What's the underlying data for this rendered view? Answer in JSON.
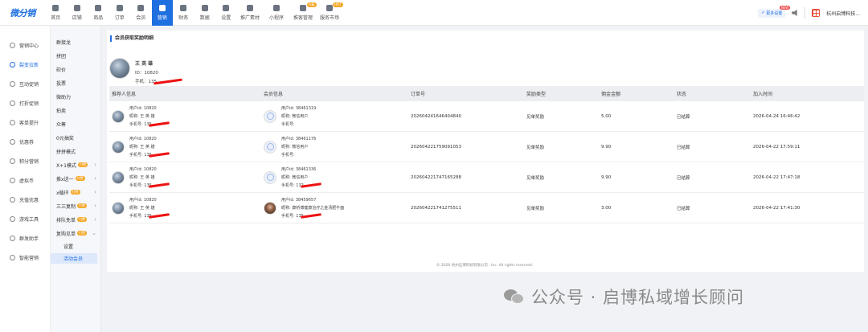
{
  "app": {
    "logo_text": "微分销"
  },
  "nav": [
    {
      "label": "首页",
      "icon": "home-icon"
    },
    {
      "label": "店铺",
      "icon": "shop-icon"
    },
    {
      "label": "商品",
      "icon": "goods-icon"
    },
    {
      "label": "订单",
      "icon": "order-icon"
    },
    {
      "label": "会员",
      "icon": "member-icon"
    },
    {
      "label": "营销",
      "icon": "marketing-icon",
      "active": true
    },
    {
      "label": "财务",
      "icon": "finance-icon"
    },
    {
      "label": "数据",
      "icon": "data-icon"
    },
    {
      "label": "设置",
      "icon": "settings-icon"
    },
    {
      "label": "推广素材",
      "icon": "share-icon"
    },
    {
      "label": "小程序",
      "icon": "miniapp-icon"
    },
    {
      "label": "推客管理",
      "icon": "promoter-icon",
      "tag": "升级"
    },
    {
      "label": "服务市场",
      "icon": "market-icon",
      "tag": "HOT"
    }
  ],
  "topright": {
    "more_settings": "更多设置",
    "new_badge": "NEW",
    "company": "杭州启博科技..."
  },
  "side1": [
    {
      "label": "营销中心"
    },
    {
      "label": "裂变拉新",
      "active": true
    },
    {
      "label": "互动促销"
    },
    {
      "label": "打折促销"
    },
    {
      "label": "客单提升"
    },
    {
      "label": "优惠券"
    },
    {
      "label": "积分营销"
    },
    {
      "label": "虚拟币"
    },
    {
      "label": "充值优惠"
    },
    {
      "label": "游戏工具"
    },
    {
      "label": "群发助手"
    },
    {
      "label": "智能营销"
    }
  ],
  "side2": {
    "items": [
      {
        "label": "群接龙"
      },
      {
        "label": "拼团"
      },
      {
        "label": "砍价"
      },
      {
        "label": "投票"
      },
      {
        "label": "微助力"
      },
      {
        "label": "拍卖"
      },
      {
        "label": "众筹"
      },
      {
        "label": "0元抽奖"
      },
      {
        "label": "拼拼模式"
      }
    ],
    "badged": [
      {
        "label": "X+1模式",
        "badge": "付费"
      },
      {
        "label": "推x送一",
        "badge": "付费"
      },
      {
        "label": "x循环",
        "badge": "付费"
      },
      {
        "label": "三三复制",
        "badge": "付费"
      },
      {
        "label": "排队免单",
        "badge": "付费"
      },
      {
        "label": "复购见单",
        "badge": "付费"
      }
    ],
    "sub": [
      {
        "label": "设置"
      },
      {
        "label": "活动会员",
        "active": true
      }
    ]
  },
  "main": {
    "title": "会员获取奖励明细",
    "member": {
      "name": "王 英 雄",
      "id": "ID：10820",
      "phone": "手机：135"
    },
    "columns": [
      "推荐人信息",
      "会员信息",
      "订单号",
      "奖励类型",
      "佣金金额",
      "状态",
      "加入时间"
    ],
    "rows": [
      {
        "ref_id": "用户id: 10820",
        "ref_name": "昵称: 王 英 雄",
        "ref_phone": "手机号: 135",
        "mem_id": "用户id: 38461319",
        "mem_name": "昵称: 微信用户",
        "mem_phone": "手机号: ",
        "order": "202604241646404840",
        "type": "见单奖励",
        "amount": "5.00",
        "status": "已结算",
        "time": "2026-04-24 16:46:42"
      },
      {
        "ref_id": "用户id: 10820",
        "ref_name": "昵称: 王 英 雄",
        "ref_phone": "手机号: 135",
        "mem_id": "用户id: 38461176",
        "mem_name": "昵称: 微信用户",
        "mem_phone": "手机号: ",
        "order": "202604221759091053",
        "type": "见单奖励",
        "amount": "9.90",
        "status": "已结算",
        "time": "2026-04-22 17:59:11"
      },
      {
        "ref_id": "用户id: 10820",
        "ref_name": "昵称: 王 英 雄",
        "ref_phone": "手机号: 135",
        "mem_id": "用户id: 38461336",
        "mem_name": "昵称: 微信用户",
        "mem_phone": "手机号: 132",
        "order": "202604221747165288",
        "type": "见单奖励",
        "amount": "9.90",
        "status": "已结算",
        "time": "2026-04-22 17:47:18"
      },
      {
        "ref_id": "用户id: 10820",
        "ref_name": "昵称: 王 英 雄",
        "ref_phone": "手机号: 135",
        "mem_id": "用户id: 38459657",
        "mem_name": "昵称: 康桥博健康治疗之金汤肥牛面",
        "mem_phone": "手机号: 135",
        "order": "202604221741275511",
        "type": "见单奖励",
        "amount": "3.00",
        "status": "已结算",
        "time": "2026-04-22 17:41:30"
      }
    ]
  },
  "footer": "© 2026 杭州启博科技有限公司 , Inc. All rights reserved.",
  "watermark": "公众号 · 启博私域增长顾问",
  "colors": {
    "accent": "#1e6fe0",
    "badge": "#f5a623"
  }
}
